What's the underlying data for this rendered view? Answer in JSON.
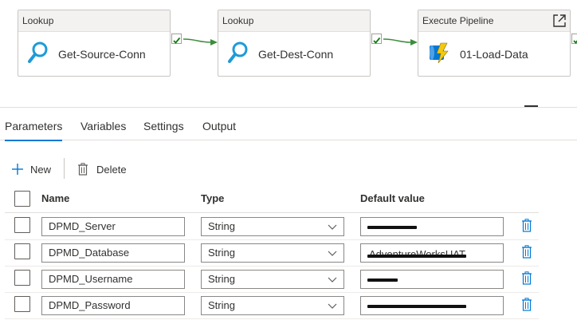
{
  "canvas": {
    "activities": [
      {
        "type": "Lookup",
        "name": "Get-Source-Conn",
        "icon": "search-icon"
      },
      {
        "type": "Lookup",
        "name": "Get-Dest-Conn",
        "icon": "search-icon"
      },
      {
        "type": "Execute Pipeline",
        "name": "01-Load-Data",
        "icon": "execute-pipeline-icon"
      }
    ]
  },
  "tabs": [
    {
      "label": "Parameters",
      "active": true
    },
    {
      "label": "Variables",
      "active": false
    },
    {
      "label": "Settings",
      "active": false
    },
    {
      "label": "Output",
      "active": false
    }
  ],
  "toolbar": {
    "new_label": "New",
    "delete_label": "Delete"
  },
  "table": {
    "headers": {
      "name": "Name",
      "type": "Type",
      "default": "Default value"
    },
    "rows": [
      {
        "name": "DPMD_Server",
        "type": "String",
        "default": ""
      },
      {
        "name": "DPMD_Database",
        "type": "String",
        "default": "AdventureWorksUAT"
      },
      {
        "name": "DPMD_Username",
        "type": "String",
        "default": ""
      },
      {
        "name": "DPMD_Password",
        "type": "String",
        "default": ""
      }
    ]
  },
  "colors": {
    "accent": "#0078d4",
    "success": "#107c10",
    "connector": "#3c8c3c",
    "lookup_icon": "#1e9bd7"
  }
}
